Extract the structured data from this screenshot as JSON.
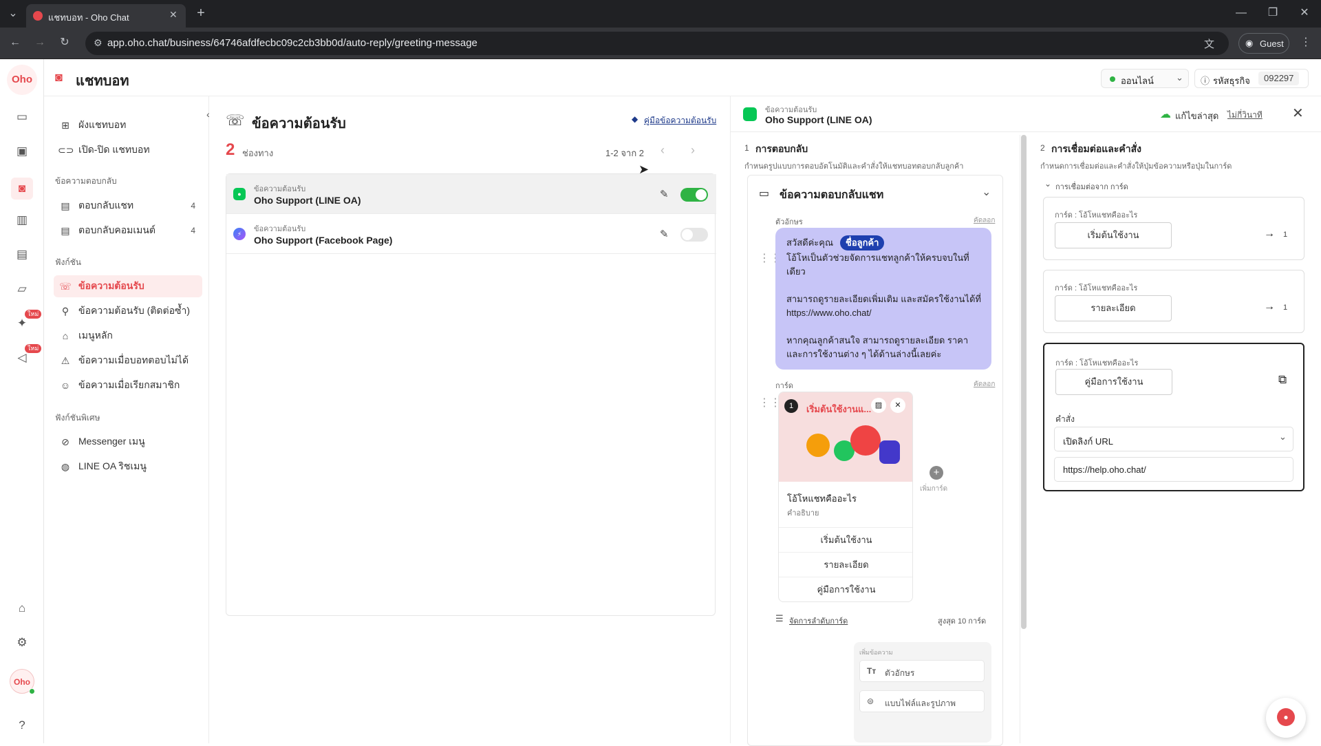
{
  "browser": {
    "tab_title": "แชทบอท - Oho Chat",
    "url": "app.oho.chat/business/64746afdfecbc09c2cb3bb0d/auto-reply/greeting-message",
    "guest_label": "Guest"
  },
  "header": {
    "title": "แชทบอท",
    "status": "ออนไลน์",
    "business_code_label": "รหัสธุรกิจ",
    "business_code": "092297"
  },
  "brand": {
    "logo_text": "Oho"
  },
  "sidebar": {
    "top_items": [
      {
        "label": "ผังแชทบอท"
      },
      {
        "label": "เปิด-ปิด แชทบอท"
      }
    ],
    "section1": "ข้อความตอบกลับ",
    "reply_items": [
      {
        "label": "ตอบกลับแชท",
        "count": "4"
      },
      {
        "label": "ตอบกลับคอมเมนต์",
        "count": "4"
      }
    ],
    "section2": "ฟังก์ชัน",
    "function_items": [
      {
        "label": "ข้อความต้อนรับ"
      },
      {
        "label": "ข้อความต้อนรับ (ติดต่อซ้ำ)"
      },
      {
        "label": "เมนูหลัก"
      },
      {
        "label": "ข้อความเมื่อบอทตอบไม่ได้"
      },
      {
        "label": "ข้อความเมื่อเรียกสมาชิก"
      }
    ],
    "section3": "ฟังก์ชันพิเศษ",
    "special_items": [
      {
        "label": "Messenger เมนู"
      },
      {
        "label": "LINE OA ริชเมนู"
      }
    ],
    "rail_badge": "ใหม่"
  },
  "middle": {
    "title": "ข้อความต้อนรับ",
    "guide_link": "คู่มือข้อความต้อนรับ",
    "channel_count": "2",
    "channel_label": "ช่องทาง",
    "pagination": "1-2 จาก 2",
    "rows": [
      {
        "type": "ข้อความต้อนรับ",
        "name": "Oho Support (LINE OA)",
        "enabled": true
      },
      {
        "type": "ข้อความต้อนรับ",
        "name": "Oho Support (Facebook Page)",
        "enabled": false
      }
    ]
  },
  "panel": {
    "type": "ข้อความต้อนรับ",
    "name": "Oho Support (LINE OA)",
    "save_status": "แก้ไขล่าสุด",
    "save_time": "ไม่กี่วินาที",
    "step1_num": "1",
    "step1_title": "การตอบกลับ",
    "step1_desc": "กำหนดรูปแบบการตอบอัตโนมัติและคำสั่งให้แชทบอทตอบกลับลูกค้า",
    "step2_num": "2",
    "step2_title": "การเชื่อมต่อและคำสั่ง",
    "step2_desc": "กำหนดการเชื่อมต่อและคำสั่งให้ปุ่มข้อความหรือปุ่มในการ์ด",
    "reply_block_title": "ข้อความตอบกลับแชท",
    "text_label": "ตัวอักษร",
    "copy_label": "คัดลอก",
    "bubble_greeting": "สวัสดีค่ะคุณ",
    "bubble_tag": "ชื่อลูกค้า",
    "bubble_line1": "โอ้โหเป็นตัวช่วยจัดการแชทลูกค้าให้ครบจบในที่เดียว",
    "bubble_line2": "สามารถดูรายละเอียดเพิ่มเติม และสมัครใช้งานได้ที่ https://www.oho.chat/",
    "bubble_line3": "หากคุณลูกค้าสนใจ สามารถดูรายละเอียด ราคา และการใช้งานต่าง ๆ ได้ด้านล่างนี้เลยค่ะ",
    "card_label": "การ์ด",
    "card_badge": "1",
    "card_banner_text": "เริ่มต้นใช้งานแ...",
    "card_title": "โอ้โหแชทคืออะไร",
    "card_desc": "คำอธิบาย",
    "card_buttons": [
      "เริ่มต้นใช้งาน",
      "รายละเอียด",
      "คู่มือการใช้งาน"
    ],
    "add_card": "เพิ่มการ์ด",
    "manage_cards": "จัดการลำดับการ์ด",
    "max_cards": "สูงสุด 10 การ์ด",
    "add_message_label": "เพิ่มข้อความ",
    "add_text": "ตัวอักษร",
    "add_file": "แบบไฟล์และรูปภาพ",
    "connect_from": "การเชื่อมต่อจาก การ์ด",
    "connections": [
      {
        "label": "การ์ด : โอ้โหแชทคืออะไร",
        "button": "เริ่มต้นใช้งาน",
        "target": "1"
      },
      {
        "label": "การ์ด : โอ้โหแชทคืออะไร",
        "button": "รายละเอียด",
        "target": "1"
      },
      {
        "label": "การ์ด : โอ้โหแชทคืออะไร",
        "button": "คู่มือการใช้งาน",
        "command_label": "คำสั่ง",
        "command": "เปิดลิงก์ URL",
        "url": "https://help.oho.chat/"
      }
    ]
  },
  "colors": {
    "brand": "#e5484d",
    "toggle_on": "#2fb344",
    "bubble": "#c7c5f7",
    "tag": "#1e40af",
    "line": "#06c755"
  }
}
